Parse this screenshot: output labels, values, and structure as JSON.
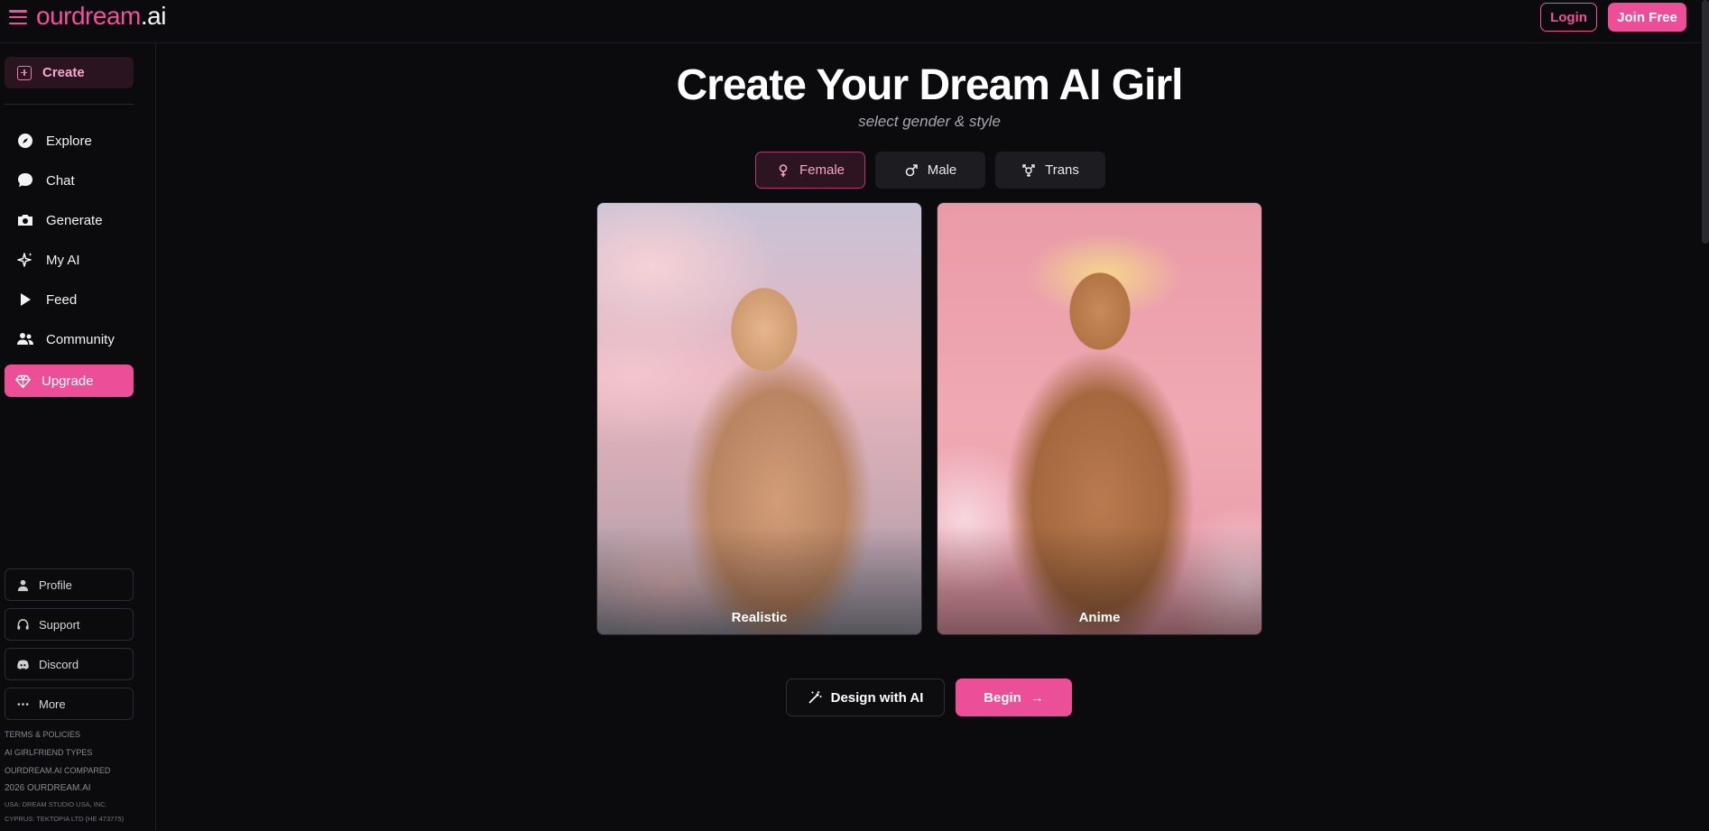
{
  "header": {
    "brand_main": "ourdream",
    "brand_suffix": ".ai",
    "login_label": "Login",
    "join_label": "Join Free"
  },
  "sidebar": {
    "create_label": "Create",
    "items": [
      {
        "label": "Explore",
        "icon": "compass-icon"
      },
      {
        "label": "Chat",
        "icon": "chat-bubble-icon"
      },
      {
        "label": "Generate",
        "icon": "camera-icon"
      },
      {
        "label": "My AI",
        "icon": "sparkle-icon"
      },
      {
        "label": "Feed",
        "icon": "play-icon"
      },
      {
        "label": "Community",
        "icon": "users-icon"
      }
    ],
    "upgrade_label": "Upgrade",
    "bottom_links": [
      {
        "label": "Profile",
        "icon": "user-icon"
      },
      {
        "label": "Support",
        "icon": "headset-icon"
      },
      {
        "label": "Discord",
        "icon": "discord-icon"
      },
      {
        "label": "More",
        "icon": "ellipsis-icon"
      }
    ],
    "legal": {
      "terms": "TERMS & POLICIES",
      "types": "AI GIRLFRIEND TYPES",
      "compared": "OURDREAM.AI COMPARED",
      "copyright": "2026 OURDREAM.AI",
      "usa": "USA: DREAM STUDIO USA, INC.",
      "cyprus": "CYPRUS: TEKTOPIA LTD (HE 473775)"
    }
  },
  "main": {
    "title": "Create Your Dream AI Girl",
    "subtitle": "select gender & style",
    "gender_tabs": [
      {
        "label": "Female",
        "icon": "female-symbol-icon",
        "active": true
      },
      {
        "label": "Male",
        "icon": "male-symbol-icon",
        "active": false
      },
      {
        "label": "Trans",
        "icon": "transgender-symbol-icon",
        "active": false
      }
    ],
    "styles": [
      {
        "label": "Realistic"
      },
      {
        "label": "Anime"
      }
    ],
    "design_label": "Design with AI",
    "begin_label": "Begin",
    "begin_arrow": "→"
  },
  "colors": {
    "accent": "#ec4f98",
    "background": "#0b0b0d"
  }
}
